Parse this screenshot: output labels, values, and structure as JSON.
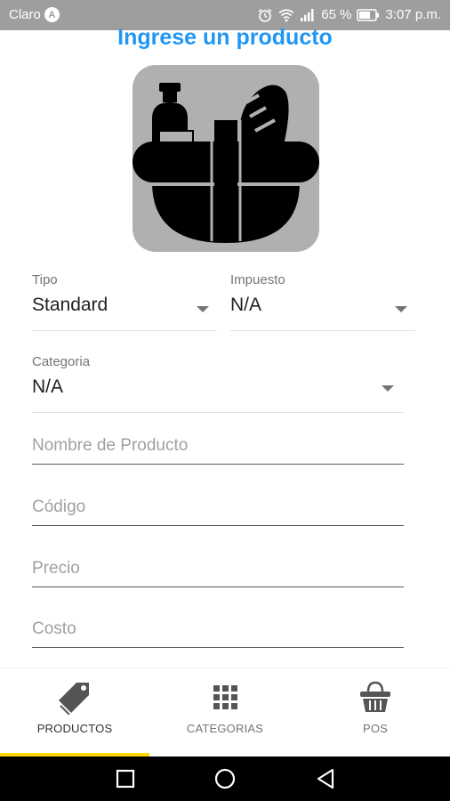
{
  "status_bar": {
    "carrier": "Claro",
    "carrier_badge": "A",
    "battery": "65 %",
    "time": "3:07 p.m."
  },
  "page": {
    "title": "Ingrese un producto"
  },
  "form": {
    "tipo": {
      "label": "Tipo",
      "value": "Standard"
    },
    "impuesto": {
      "label": "Impuesto",
      "value": "N/A"
    },
    "categoria": {
      "label": "Categoria",
      "value": "N/A"
    },
    "nombre": {
      "placeholder": "Nombre de Producto"
    },
    "codigo": {
      "placeholder": "Código"
    },
    "precio": {
      "placeholder": "Precio"
    },
    "costo": {
      "placeholder": "Costo"
    }
  },
  "bottom_nav": {
    "items": [
      {
        "label": "PRODUCTOS",
        "icon": "tag-icon",
        "active": true
      },
      {
        "label": "CATEGORIAS",
        "icon": "grid-icon",
        "active": false
      },
      {
        "label": "POS",
        "icon": "basket-icon",
        "active": false
      }
    ]
  },
  "colors": {
    "accent": "#2196f3",
    "active_indicator": "#ffd600",
    "status_bar": "#9e9e9e"
  }
}
